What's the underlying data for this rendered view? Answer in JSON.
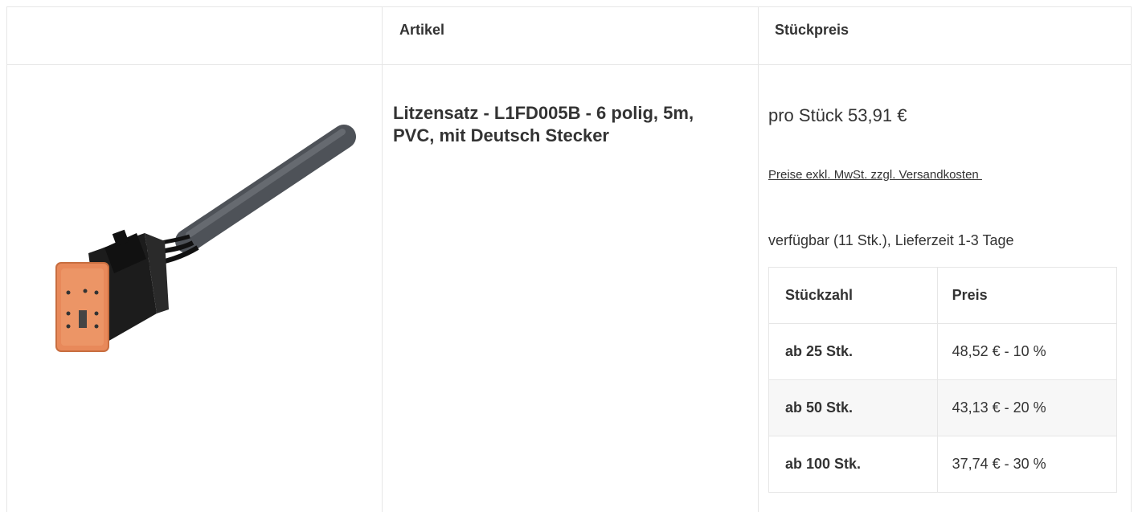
{
  "table_header": {
    "image_col": "",
    "article_col": "Artikel",
    "price_col": "Stückpreis"
  },
  "product": {
    "image": "harness-connector-image",
    "title": "Litzensatz - L1FD005B - 6 polig, 5m, PVC, mit Deutsch Stecker",
    "unit_price": "pro Stück 53,91 €",
    "price_note": "Preise exkl. MwSt. zzgl. Versandkosten ",
    "availability": "verfügbar (11 Stk.), Lieferzeit 1-3 Tage"
  },
  "tier_table": {
    "headers": [
      "Stückzahl",
      "Preis"
    ],
    "rows": [
      {
        "qty": "ab 25 Stk.",
        "price": "48,52 € - 10 %"
      },
      {
        "qty": "ab 50 Stk.",
        "price": "43,13 € - 20 %"
      },
      {
        "qty": "ab 100 Stk.",
        "price": "37,74 € - 30 %"
      }
    ]
  },
  "colors": {
    "border": "#e6e6e6",
    "text": "#333333",
    "row_shade": "#f7f7f7",
    "connector_orange": "#e8895a",
    "connector_body": "#1c1c1c",
    "cable_gray": "#5b5f66"
  }
}
